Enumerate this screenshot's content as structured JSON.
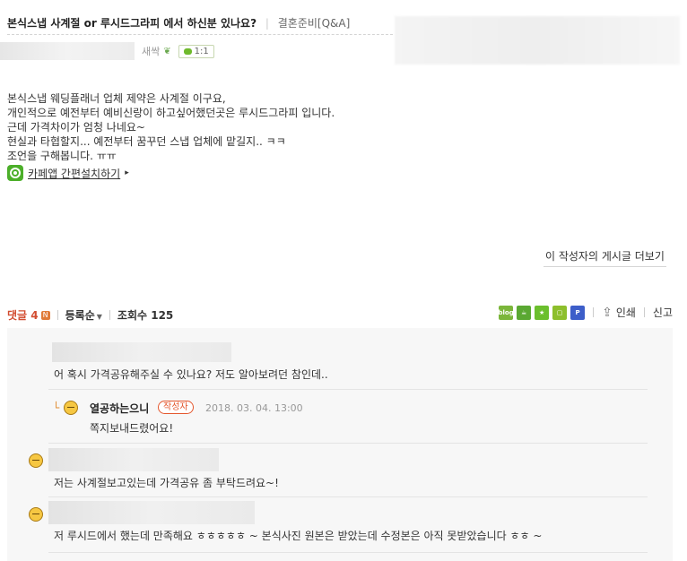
{
  "post": {
    "title": "본식스냅 사계절 or 루시드그라피 에서 하신분 있나요?",
    "separator": "|",
    "board": "결혼준비[Q&A]",
    "author_level": "새싹",
    "chat_badge": "1:1",
    "content_lines": [
      "본식스냅 웨딩플래너 업체 제약은 사계절 이구요,",
      "개인적으로 예전부터 예비신랑이 하고싶어했던곳은 루시드그라피 입니다.",
      "근데 가격차이가 엄청 나네요~",
      "현실과 타협할지... 예전부터 꿈꾸던 스냅 업체에 맡길지.. ㅋㅋ",
      "조언을 구해봅니다. ㅠㅠ"
    ],
    "app_link": "카페앱 간편설치하기",
    "more_posts": "이 작성자의 게시글 더보기"
  },
  "meta": {
    "comment_label": "댓글",
    "comment_count": "4",
    "new_badge": "N",
    "sort_label": "등록순",
    "views_label": "조회수",
    "views_count": "125",
    "share_icons": [
      "blog-icon",
      "cafe-icon",
      "star-icon",
      "memo-icon",
      "p-icon"
    ],
    "share_colors": [
      "#7bb63a",
      "#5aa832",
      "#6bbf2d",
      "#8dbf2c",
      "#3d5ec9"
    ],
    "share_text": "blog",
    "print_label": "인쇄",
    "report_label": "신고"
  },
  "comments": [
    {
      "text": "어 혹시 가격공유해주실 수 있나요? 저도 알아보려던 참인데.."
    },
    {
      "reply_name": "열공하는으니",
      "writer_badge": "작성자",
      "date": "2018. 03. 04.  13:00",
      "text": "쪽지보내드렸어요!"
    },
    {
      "text": "저는 사계절보고있는데 가격공유 좀 부탁드려요~!"
    },
    {
      "text": "저 루시드에서 했는데 만족해요 ㅎㅎㅎㅎㅎ ~ 본식사진 원본은 받았는데 수정본은 아직 못받았습니다 ㅎㅎ ~"
    }
  ]
}
